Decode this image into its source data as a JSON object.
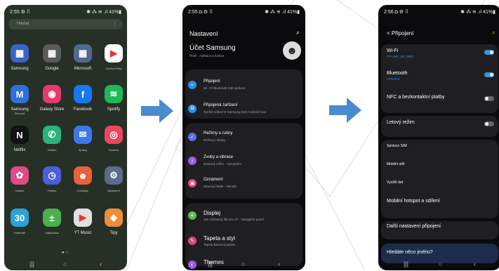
{
  "colors": {
    "arrow": "#4a8bd0",
    "toggle_on": "#3a8ee6",
    "link_blue": "#2f8fe8"
  },
  "phone1": {
    "status": {
      "time": "2:55 ⚙ ⠿",
      "right": "✱ ⁂ ≋ .ıl 41%▮"
    },
    "search_placeholder": "Hledat",
    "search_menu": "⋮",
    "apps": [
      {
        "label": "Samsung",
        "icon": "samsung-folder-icon",
        "glyph": "▦",
        "color": "#3a64c7"
      },
      {
        "label": "Google",
        "icon": "google-folder-icon",
        "glyph": "▦",
        "color": "#5a5a5a"
      },
      {
        "label": "Microsoft",
        "icon": "microsoft-folder-icon",
        "glyph": "▦",
        "color": "#4f6a8f"
      },
      {
        "label": "Obchod Play",
        "icon": "play-store-icon",
        "glyph": "▶",
        "color": "#ffffff",
        "small": true
      },
      {
        "label": "Samsung",
        "sub": "Členové",
        "icon": "samsung-members-icon",
        "glyph": "M",
        "color": "#2d6fdc"
      },
      {
        "label": "Galaxy Store",
        "icon": "galaxy-store-icon",
        "glyph": "◉",
        "color": "#e63a6e"
      },
      {
        "label": "Facebook",
        "icon": "facebook-icon",
        "glyph": "f",
        "color": "#1877f2"
      },
      {
        "label": "Spotify",
        "icon": "spotify-icon",
        "glyph": "≋",
        "color": "#1db954"
      },
      {
        "label": "Netflix",
        "icon": "netflix-icon",
        "glyph": "N",
        "color": "#111111"
      },
      {
        "label": "Telefon",
        "icon": "phone-icon",
        "glyph": "✆",
        "color": "#2ab37a",
        "small": true
      },
      {
        "label": "Zprávy",
        "icon": "messages-icon",
        "glyph": "✉",
        "color": "#3c79e6",
        "small": true
      },
      {
        "label": "Kamera",
        "icon": "camera-icon",
        "glyph": "◎",
        "color": "#e8485f",
        "small": true
      },
      {
        "label": "Galerie",
        "icon": "gallery-icon",
        "glyph": "✿",
        "color": "#e04a86",
        "small": true
      },
      {
        "label": "Hodiny",
        "icon": "clock-icon",
        "glyph": "◷",
        "color": "#4a5fd9",
        "small": true
      },
      {
        "label": "Kontakty",
        "icon": "contacts-icon",
        "glyph": "☻",
        "color": "#e8603c",
        "small": true
      },
      {
        "label": "Nastavení",
        "icon": "settings-gear-icon",
        "glyph": "⚙",
        "color": "#5a6c8a",
        "small": true
      },
      {
        "label": "Kalendář",
        "icon": "calendar-icon",
        "glyph": "30",
        "color": "#2aa3d8",
        "small": true
      },
      {
        "label": "Kalkulačka",
        "icon": "calculator-icon",
        "glyph": "±",
        "color": "#4caf50",
        "small": true
      },
      {
        "label": "YT Music",
        "icon": "yt-music-icon",
        "glyph": "▶",
        "color": "#e0e0e0"
      },
      {
        "label": "Tipy",
        "icon": "tips-icon",
        "glyph": "◆",
        "color": "#f08c3a"
      }
    ],
    "page_dots": "● ○",
    "nav": {
      "recents": "|||",
      "home": "○",
      "back": "‹"
    }
  },
  "phone2": {
    "status": {
      "time": "2:55 ◘ ⚙ ⠿",
      "right": "✱ ⁂ ≋ .ıl 41%▮"
    },
    "title": "Nastavení",
    "search": "⌕",
    "account": {
      "title": "Účet Samsung",
      "subtitle": "Profil · Aplikace a funkce"
    },
    "rows": [
      {
        "title": "Připojení",
        "sub": "Wi - Fi Bluetooth SIM správce",
        "icon": "wifi-icon",
        "glyph": "≈",
        "color": "#2f8fe8"
      },
      {
        "title": "Připojená zařízení",
        "sub": "Rychlé sdílení ● Samsung DeX Android Auto",
        "icon": "connected-devices-icon",
        "glyph": "⧉",
        "color": "#2f8fe8"
      },
      {
        "title": "Režimy a rutiny",
        "sub": "Režimy | Rutiny",
        "icon": "modes-icon",
        "glyph": "✓",
        "color": "#5b6fe8"
      },
      {
        "title": "Zvuky a vibrace",
        "sub": "Zvukový režim · Vyzvánění",
        "icon": "sound-icon",
        "glyph": "♪",
        "color": "#9b5ee8"
      },
      {
        "title": "Oznámení",
        "sub": "Stavový řádek · Nerušit",
        "icon": "notification-icon",
        "glyph": "▣",
        "color": "#e0447a"
      },
      {
        "title": "Displej",
        "sub": "Jas Ochranný lék pro oči · Navigační panel",
        "icon": "display-icon",
        "glyph": "☀",
        "color": "#5bbf4a",
        "big": true
      },
      {
        "title": "Tapeta a styl",
        "sub": "Tapety Barevná paleta",
        "icon": "wallpaper-icon",
        "glyph": "✎",
        "color": "#e0447a",
        "big": true
      },
      {
        "title": "Themes",
        "sub": "",
        "icon": "themes-icon",
        "glyph": "◐",
        "color": "#9b5ee8",
        "big": true
      }
    ],
    "nav": {
      "recents": "|||",
      "home": "○",
      "back": "‹"
    }
  },
  "phone3": {
    "status": {
      "time": "2:56 ◘ ⚙ ⠿",
      "right": "✱ ⁂ ≋ .ıl 41%▮"
    },
    "title": "< Připojení",
    "search": "⌕",
    "rows": [
      {
        "title": "Wi-Fi",
        "sub": "TP-LINK_5G_96B7",
        "toggle": "on"
      },
      {
        "title": "Bluetooth",
        "sub": "XTRONS",
        "toggle": "on"
      },
      {
        "title": "NFC a bezkontaktní platby",
        "sub": "",
        "toggle": "off"
      },
      {
        "title": "Letový režim",
        "sub": "",
        "toggle": "off"
      },
      {
        "title": "Správce SIM",
        "sub": "",
        "toggle": ""
      },
      {
        "title": "Mobilní sítě",
        "sub": "",
        "toggle": ""
      },
      {
        "title": "Využití dat",
        "sub": "",
        "toggle": ""
      },
      {
        "title": "Mobilní hotspot a sdílení",
        "sub": "",
        "toggle": ""
      },
      {
        "title": "Další nastavení připojení",
        "sub": "",
        "toggle": ""
      }
    ],
    "hint": "Hledáte něco jiného?",
    "nav": {
      "recents": "|||",
      "home": "○",
      "back": "‹"
    }
  }
}
